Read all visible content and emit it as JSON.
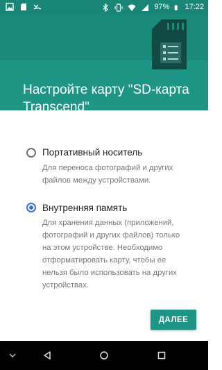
{
  "status_bar": {
    "battery": "97%",
    "time": "17:22",
    "left_icons": [
      "image-icon",
      "sd-card-icon",
      "missed-call-icon"
    ],
    "right_icons": [
      "bluetooth-icon",
      "vibrate-icon",
      "wifi-icon",
      "signal-icon",
      "battery-icon"
    ]
  },
  "header": {
    "title": "Настройте карту \"SD-карта Transcend\"",
    "icon": "sd-card-icon"
  },
  "options": [
    {
      "title": "Портативный носитель",
      "description": "Для переноса фотографий и других файлов между устройствами.",
      "selected": false
    },
    {
      "title": "Внутренняя память",
      "description": "Для хранения данных (приложений, фотографий и других файлов) только на этом устройстве. Необходимо отформатировать карту, чтобы ее нельзя было использовать на других устройствах.",
      "selected": true
    }
  ],
  "actions": {
    "next_label": "ДАЛЕЕ"
  },
  "colors": {
    "accent": "#1f9685",
    "status_bar": "#1a8677",
    "radio_selected": "#3b6fd6"
  },
  "nav_bar": {
    "buttons": [
      "collapse-icon",
      "back-icon",
      "home-icon",
      "recents-icon"
    ]
  }
}
